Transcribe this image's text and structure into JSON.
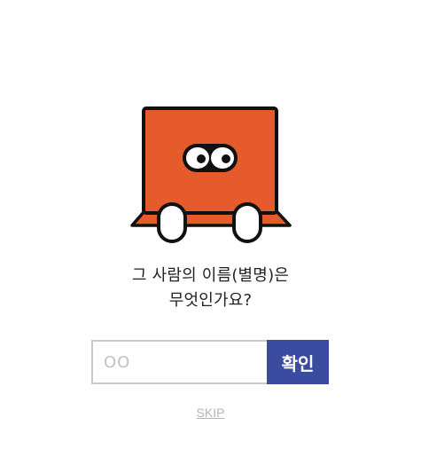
{
  "colors": {
    "mascot_body": "#e55b2b",
    "outline": "#111111",
    "button_bg": "#3a4ba0",
    "skip_text": "#b5b5b5"
  },
  "icons": {
    "mascot": "orange-box-character-icon"
  },
  "question": {
    "line1": "그 사람의 이름(별명)은",
    "line2": "무엇인가요?"
  },
  "form": {
    "name_placeholder": "OO",
    "name_value": "",
    "confirm_label": "확인"
  },
  "skip_label": "SKIP"
}
